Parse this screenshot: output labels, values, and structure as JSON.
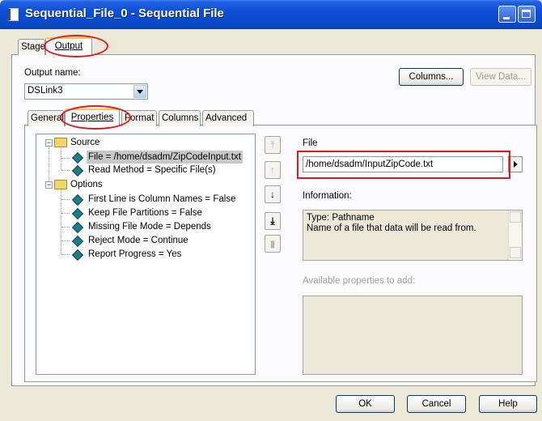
{
  "window": {
    "title": "Sequential_File_0 - Sequential File"
  },
  "top_tabs": [
    {
      "label": "Stage"
    },
    {
      "label": "Output"
    }
  ],
  "output_name": {
    "label": "Output name:",
    "value": "DSLink3"
  },
  "top_buttons": {
    "columns": "Columns...",
    "view_data": "View Data..."
  },
  "sub_tabs": [
    {
      "label": "General"
    },
    {
      "label": "Properties"
    },
    {
      "label": "Format"
    },
    {
      "label": "Columns"
    },
    {
      "label": "Advanced"
    }
  ],
  "tree": {
    "source": {
      "label": "Source",
      "toggle": "−"
    },
    "source_items": [
      {
        "label": "File = /home/dsadm/ZipCodeInput.txt"
      },
      {
        "label": "Read Method = Specific File(s)"
      }
    ],
    "options": {
      "label": "Options",
      "toggle": "−"
    },
    "option_items": [
      {
        "label": "First Line is Column Names = False"
      },
      {
        "label": "Keep File Partitions = False"
      },
      {
        "label": "Missing File Mode = Depends"
      },
      {
        "label": "Reject Mode = Continue"
      },
      {
        "label": "Report Progress = Yes"
      }
    ]
  },
  "side_buttons": {
    "top": "⤒",
    "up": "↑",
    "down": "↓",
    "bottom": "⤓",
    "remove": "▮"
  },
  "file": {
    "label": "File",
    "value": "/home/dsadm/InputZipCode.txt"
  },
  "information": {
    "label": "Information:",
    "text": "Type: Pathname\nName of a file that data will be read from."
  },
  "available": {
    "label": "Available properties to add:"
  },
  "dialog_buttons": {
    "ok": "OK",
    "cancel": "Cancel",
    "help": "Help"
  },
  "colors": {
    "titlebar": "#0a48c6",
    "annotation": "#e0181b",
    "face": "#ece9d8"
  }
}
